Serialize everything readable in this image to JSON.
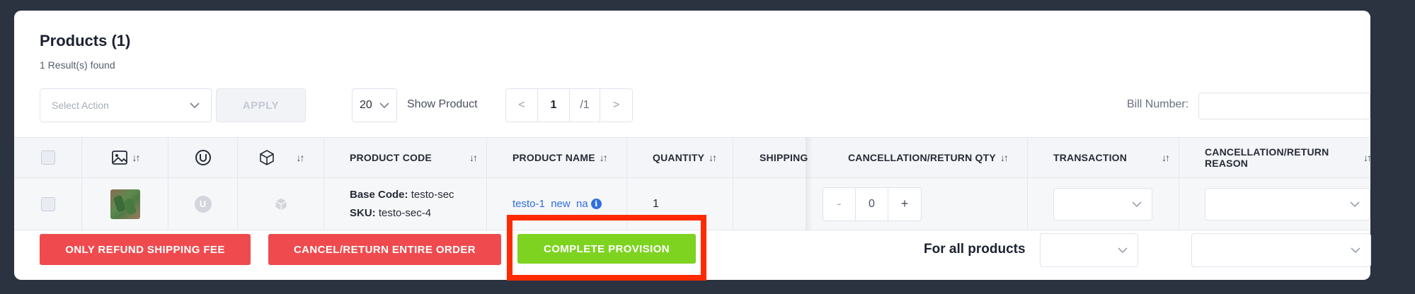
{
  "header": {
    "title": "Products (1)",
    "subtitle": "1 Result(s) found"
  },
  "toolbar": {
    "select_action_placeholder": "Select Action",
    "apply_label": "APPLY",
    "per_page": "20",
    "show_product_label": "Show Product",
    "pagination": {
      "prev": "<",
      "current": "1",
      "total": "/1",
      "next": ">"
    },
    "bill_number_label": "Bill Number:",
    "bill_number_value": ""
  },
  "table": {
    "columns": {
      "product_code": "PRODUCT CODE",
      "product_name": "PRODUCT NAME",
      "quantity": "QUANTITY",
      "shipping": "SHIPPING",
      "cancellation_qty": "CANCELLATION/RETURN QTY",
      "transaction": "TRANSACTION",
      "cancellation_reason": "CANCELLATION/RETURN REASON"
    },
    "sort_glyph": "↓↑",
    "rows": [
      {
        "base_code_label": "Base Code:",
        "base_code": "testo-sec",
        "sku_label": "SKU:",
        "sku": "testo-sec-4",
        "product_name": "testo-1  new  na",
        "quantity": "1",
        "stepper": {
          "minus": "-",
          "value": "0",
          "plus": "+"
        }
      }
    ]
  },
  "footer": {
    "refund_shipping_label": "ONLY REFUND SHIPPING FEE",
    "cancel_order_label": "CANCEL/RETURN ENTIRE ORDER",
    "complete_provision_label": "COMPLETE PROVISION",
    "for_all_products_label": "For all products"
  },
  "icons": {
    "dropdown": "chevron-down-icon",
    "image_column": "image-icon",
    "brand_column": "u-logo-icon",
    "package_column": "box-icon",
    "info": "info-icon"
  },
  "colors": {
    "background": "#2b3240",
    "danger": "#ef4b4f",
    "success": "#7ed321",
    "highlight": "#ff2a00",
    "link": "#2f6fe0"
  }
}
